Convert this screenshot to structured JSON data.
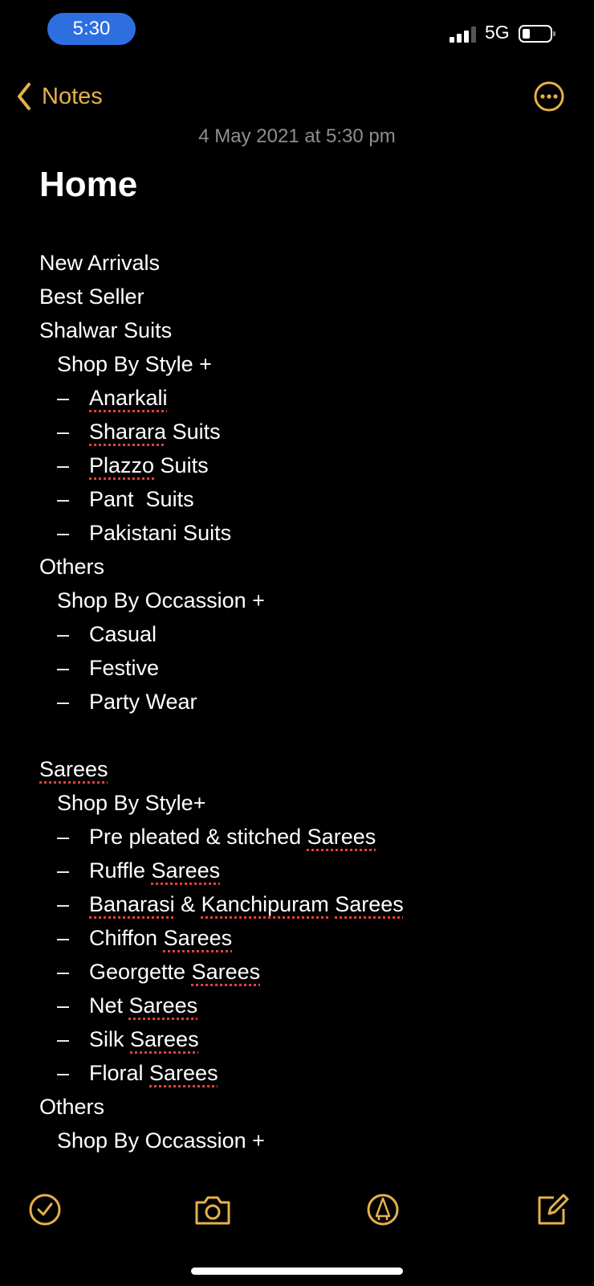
{
  "status_bar": {
    "time": "5:30",
    "network": "5G"
  },
  "nav": {
    "back_label": "Notes"
  },
  "note": {
    "date": "4 May 2021 at 5:30 pm",
    "title": "Home"
  },
  "lines": [
    {
      "text": "New Arrivals"
    },
    {
      "text": "Best Seller"
    },
    {
      "text": "Shalwar Suits"
    },
    {
      "text": "Shop By Style +"
    },
    {
      "dash": "–",
      "text": "Anarkali"
    },
    {
      "dash": "–",
      "text": "Sharara",
      "text2": " Suits"
    },
    {
      "dash": "–",
      "text": "Plazzo",
      "text2": " Suits"
    },
    {
      "dash": "–",
      "text": "Pant  Suits"
    },
    {
      "dash": "–",
      "text": "Pakistani Suits"
    },
    {
      "text": "Others"
    },
    {
      "text": "Shop By Occassion +"
    },
    {
      "dash": "–",
      "text": "Casual"
    },
    {
      "dash": "–",
      "text": "Festive"
    },
    {
      "dash": "–",
      "text": "Party Wear"
    },
    {
      "text": ""
    },
    {
      "text": "Sarees"
    },
    {
      "text": "Shop By Style+"
    },
    {
      "dash": "–",
      "text": "Pre pleated & stitched ",
      "text2": "Sarees"
    },
    {
      "dash": "–",
      "text": "Ruffle ",
      "text2": "Sarees"
    },
    {
      "dash": "–",
      "text": "Banarasi",
      "text2": " & ",
      "text3": "Kanchipuram",
      "text4": " ",
      "text5": "Sarees"
    },
    {
      "dash": "–",
      "text": "Chiffon ",
      "text2": "Sarees"
    },
    {
      "dash": "–",
      "text": "Georgette ",
      "text2": "Sarees"
    },
    {
      "dash": "–",
      "text": "Net ",
      "text2": "Sarees"
    },
    {
      "dash": "–",
      "text": "Silk ",
      "text2": "Sarees"
    },
    {
      "dash": "–",
      "text": "Floral ",
      "text2": "Sarees"
    },
    {
      "text": "Others"
    },
    {
      "text": "Shop By Occassion +"
    }
  ],
  "colors": {
    "accent": "#e5b14a",
    "spell_error": "#e2423a",
    "background": "#000000"
  },
  "toolbar": {
    "items": [
      "checklist-icon",
      "camera-icon",
      "markup-icon",
      "compose-icon"
    ]
  }
}
